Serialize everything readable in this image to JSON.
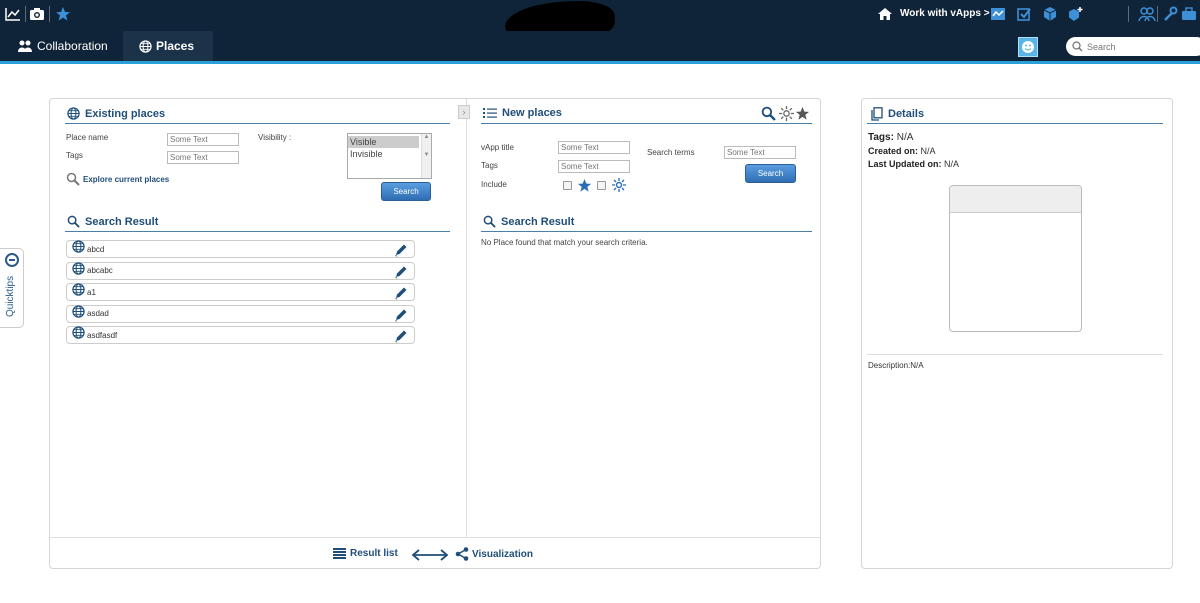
{
  "topbar": {
    "work_link": "Work with vApps >",
    "icons": [
      "line-chart-icon",
      "camera-icon",
      "star-icon",
      "home-icon",
      "dashboard-icon",
      "checkbox-icon",
      "cube-icon",
      "cube-plus-icon",
      "people-icon",
      "wrench-icon",
      "briefcase-icon"
    ]
  },
  "nav": {
    "tabs": [
      {
        "label": "Collaboration",
        "icon": "users-icon",
        "active": false
      },
      {
        "label": "Places",
        "icon": "globe-icon",
        "active": true
      }
    ],
    "search_placeholder": "Search"
  },
  "quicktips": {
    "label": "Quicktips"
  },
  "existing": {
    "title": "Existing places",
    "place_name_label": "Place name",
    "place_name_placeholder": "Some Text",
    "tags_label": "Tags",
    "tags_placeholder": "Some Text",
    "visibility_label": "Visibility :",
    "visibility_options": [
      "Visible",
      "Invisible"
    ],
    "visibility_selected": "Visible",
    "explore_link": "Explore current places",
    "search_button": "Search",
    "result_title": "Search Result",
    "results": [
      "abcd",
      "abcabc",
      "a1",
      "asdad",
      "asdfasdf"
    ]
  },
  "newplaces": {
    "title": "New places",
    "vapp_title_label": "vApp title",
    "vapp_title_placeholder": "Some Text",
    "tags_label": "Tags",
    "tags_placeholder": "Some Text",
    "include_label": "Include",
    "search_terms_label": "Search terms",
    "search_terms_placeholder": "Some Text",
    "search_button": "Search",
    "result_title": "Search Result",
    "no_result": "No Place found that match your search criteria."
  },
  "bottom": {
    "result_list": "Result list",
    "visualization": "Visualization"
  },
  "details": {
    "title": "Details",
    "tags_label": "Tags:",
    "tags_value": "N/A",
    "created_label": "Created on:",
    "created_value": "N/A",
    "updated_label": "Last Updated on:",
    "updated_value": "N/A",
    "description": "Description:N/A"
  },
  "colors": {
    "topbar_bg": "#0f2438",
    "accent_line": "#2aa0d8",
    "title_blue": "#1f4e79",
    "button_blue": "#2f6db3"
  }
}
